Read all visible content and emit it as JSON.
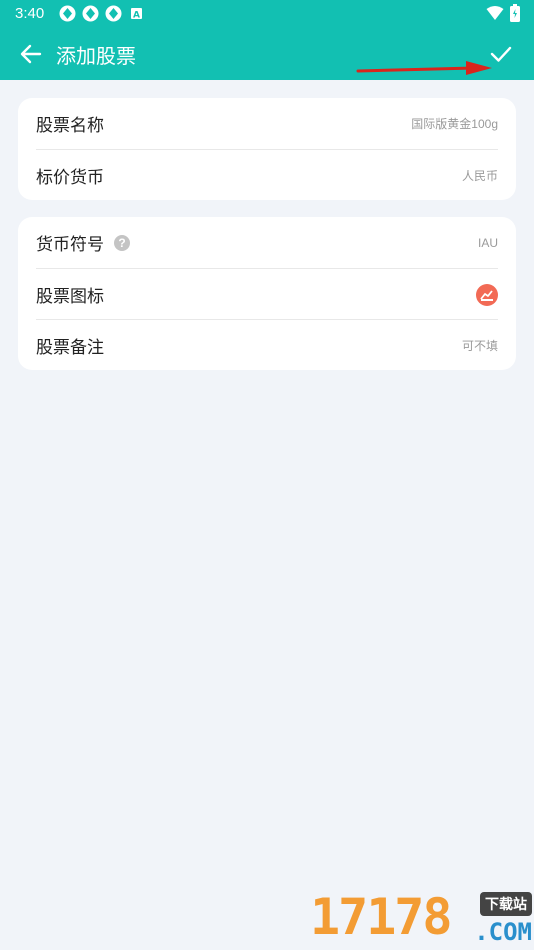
{
  "status_bar": {
    "time": "3:40",
    "notification_icons": [
      "sync-icon",
      "sync-icon",
      "sync-icon",
      "a-icon"
    ],
    "right_icons": [
      "wifi-icon",
      "battery-icon"
    ]
  },
  "app_bar": {
    "title": "添加股票",
    "back_icon": "arrow-left-icon",
    "confirm_icon": "check-icon",
    "color": "#12c0b2"
  },
  "card1": {
    "rows": [
      {
        "label": "股票名称",
        "value": "国际版黄金100g"
      },
      {
        "label": "标价货币",
        "value": "人民币"
      }
    ]
  },
  "card2": {
    "rows": [
      {
        "label": "货币符号",
        "value": "IAU",
        "help": "?"
      },
      {
        "label": "股票图标",
        "icon": "stock-icon",
        "icon_color": "#f26a55"
      },
      {
        "label": "股票备注",
        "placeholder": "可不填"
      }
    ]
  },
  "watermark": {
    "number": "17178",
    "badge": "下载站",
    "suffix": ".COM"
  }
}
